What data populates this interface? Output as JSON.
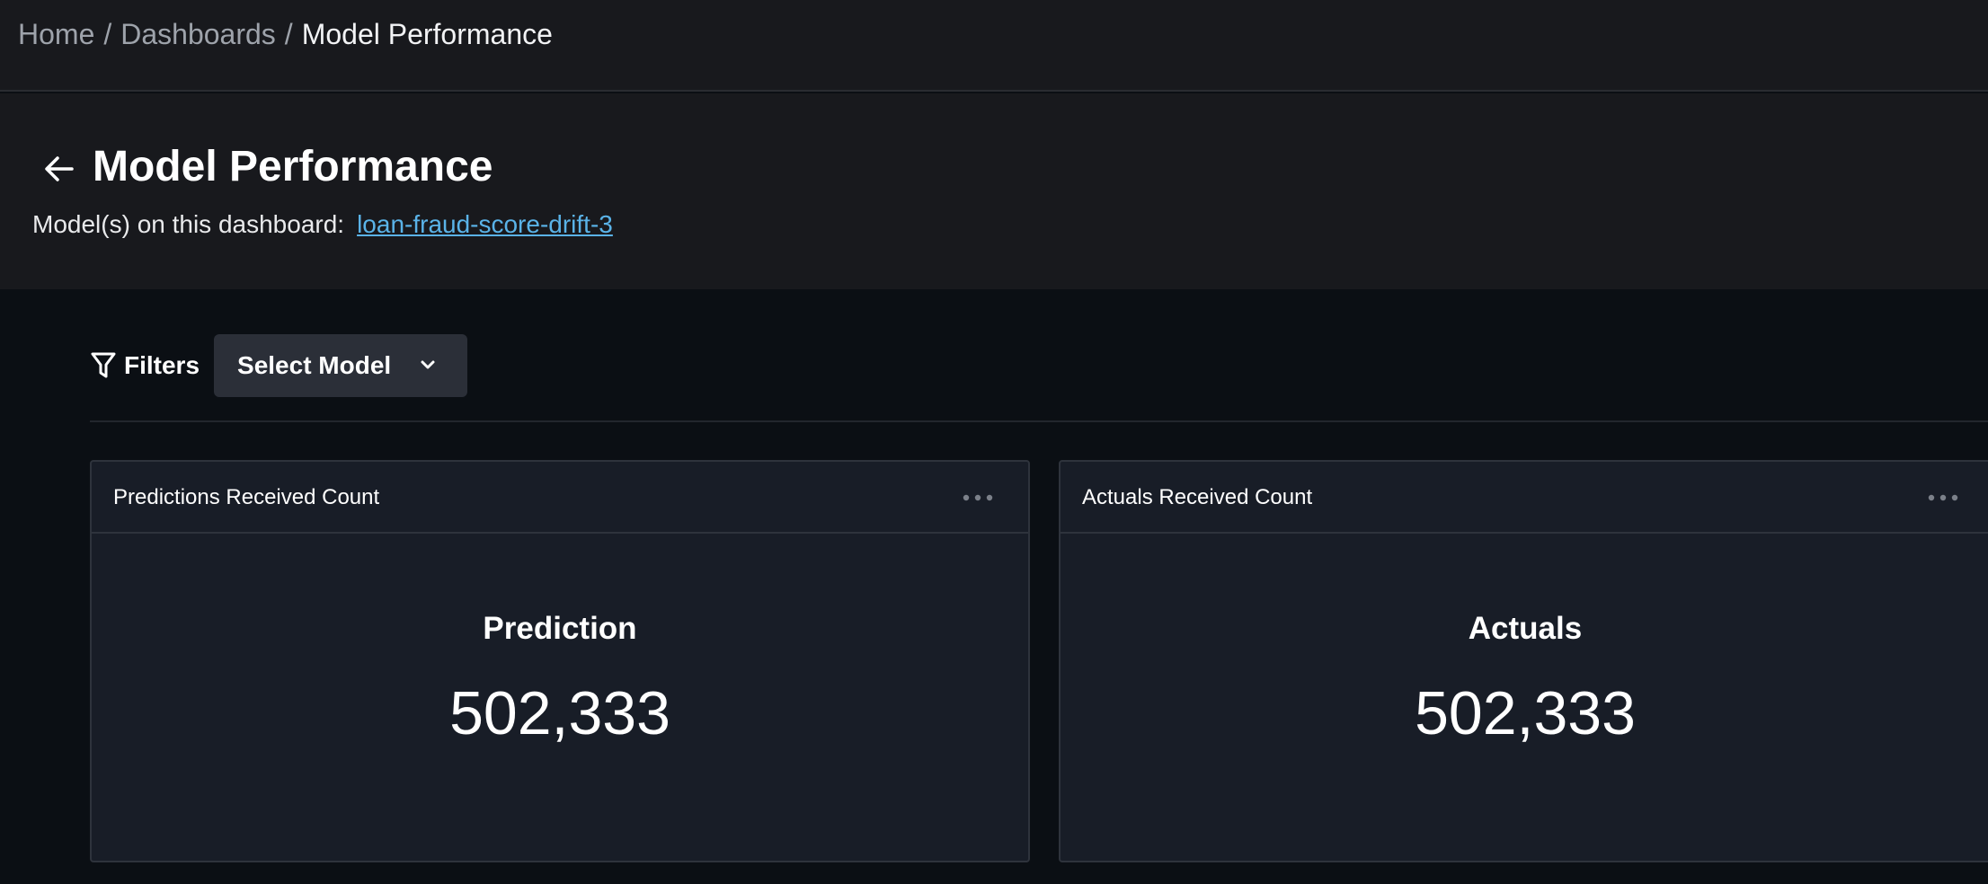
{
  "breadcrumb": {
    "home": "Home",
    "separator": "/",
    "dashboards": "Dashboards",
    "current": "Model Performance"
  },
  "header": {
    "title": "Model Performance",
    "models_label": "Model(s) on this dashboard:",
    "model_link": "loan-fraud-score-drift-3"
  },
  "filters": {
    "label": "Filters",
    "select_model": "Select Model"
  },
  "cards": [
    {
      "title": "Predictions Received Count",
      "metric_label": "Prediction",
      "metric_value": "502,333"
    },
    {
      "title": "Actuals Received Count",
      "metric_label": "Actuals",
      "metric_value": "502,333"
    }
  ],
  "icons": {
    "back": "arrow-left-icon",
    "filter": "funnel-icon",
    "dropdown": "chevron-down-icon",
    "menu": "more-horizontal-icon"
  },
  "colors": {
    "background": "#0b0f14",
    "header_bg": "#18191d",
    "card_bg": "#181d27",
    "link": "#5ab3e8",
    "select_bg": "#2b2f38"
  }
}
